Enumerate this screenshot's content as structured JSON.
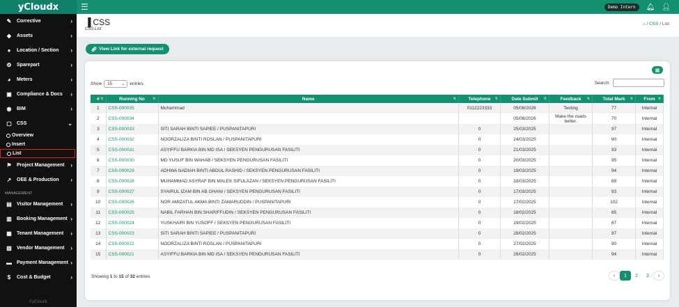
{
  "brand": "yCloudx",
  "topbar": {
    "demo_label": "Demo Intern"
  },
  "sidebar": {
    "items_top": [
      {
        "label": "Corrective",
        "icon": "wrench-icon"
      },
      {
        "label": "Assets",
        "icon": "tag-icon"
      },
      {
        "label": "Location / Section",
        "icon": "globe-icon"
      },
      {
        "label": "Sparepart",
        "icon": "sparepart-icon"
      },
      {
        "label": "Meters",
        "icon": "gauge-icon"
      },
      {
        "label": "Compliance & Docs",
        "icon": "compliance-icon"
      },
      {
        "label": "BIM",
        "icon": "bim-icon"
      },
      {
        "label": "CSS",
        "icon": "chat-icon"
      }
    ],
    "css_subs": [
      "Overview",
      "Insert",
      "List"
    ],
    "items_mid": [
      {
        "label": "Project Management",
        "icon": "flag-icon"
      },
      {
        "label": "OEE & Production",
        "icon": "chart-icon"
      }
    ],
    "section": "MANAGEMENT",
    "items_bottom": [
      {
        "label": "Visitor Management",
        "icon": "visitor-icon"
      },
      {
        "label": "Booking Management",
        "icon": "booking-icon"
      },
      {
        "label": "Tenant Management",
        "icon": "tenant-icon"
      },
      {
        "label": "Vendor Management",
        "icon": "vendor-icon"
      },
      {
        "label": "Payment Management",
        "icon": "card-icon"
      },
      {
        "label": "Cost & Budget",
        "icon": "dollar-icon"
      }
    ],
    "footer": "©yCloudx"
  },
  "page": {
    "title": "CSS",
    "subtitle": "CSS List",
    "breadcrumb": [
      "CSS",
      "List"
    ],
    "ext_button": "View Link for external request"
  },
  "table": {
    "show_label": "Show",
    "entries_label": "entries",
    "page_size": "15",
    "search_label": "Search:",
    "headers": [
      "#",
      "Running No",
      "Name",
      "Telephone",
      "Date Submit",
      "Feedback",
      "Total Mark",
      "From"
    ],
    "rows": [
      [
        "1",
        "CSS-000035",
        "Muhammad",
        "0112223333",
        "05/08/2026",
        "Testing",
        "77",
        "Internal"
      ],
      [
        "2",
        "CSS-000034",
        "",
        "",
        "05/08/2026",
        "Make the roads better.",
        "70",
        "Internal"
      ],
      [
        "3",
        "CSS-000033",
        "SITI SARAH BINTI SAPIEE / PUSPANITAPURI",
        "0",
        "25/03/2025",
        "",
        "97",
        "Internal"
      ],
      [
        "4",
        "CSS-000032",
        "NOORZALIZA BINTI ROSLAN / PUSPANITAPURI",
        "0",
        "24/03/2025",
        "",
        "90",
        "Internal"
      ],
      [
        "5",
        "CSS-000031",
        "ASYIFFU BARKIA BIN MD ISA / SEKSYEN PENGURUSAN FASILITI",
        "0",
        "21/03/2025",
        "",
        "93",
        "Internal"
      ],
      [
        "6",
        "CSS-000030",
        "MD YUSUF BIN WAHAB / SEKSYEN PENGURUSAN FASILITI",
        "0",
        "20/03/2025",
        "",
        "95",
        "Internal"
      ],
      [
        "7",
        "CSS-000029",
        "ADHWA NADIAH BINTI ABDUL RASHID / SEKSYEN PENGURUSAN FASILITI",
        "0",
        "19/03/2025",
        "",
        "94",
        "Internal"
      ],
      [
        "8",
        "CSS-000028",
        "MUHAMMAD ASYRAF BIN MALEK SIFULAZAN / SEKSYEN PENGURUSAN FASILITI",
        "0",
        "18/03/2025",
        "",
        "89",
        "Internal"
      ],
      [
        "9",
        "CSS-000027",
        "SYAIRUL IZAM BIN AB GHANI / SEKSYEN PENGURUSAN FASILITI",
        "0",
        "17/03/2025",
        "",
        "93",
        "Internal"
      ],
      [
        "10",
        "CSS-000026",
        "NOR AMIZATUL AKMA BINTI ZAMARUDDIN / PUSPANITAPURI",
        "0",
        "17/02/2025",
        "",
        "102",
        "Internal"
      ],
      [
        "11",
        "CSS-000025",
        "NABIL FARHAN BIN SHARIFFUDIN / SEKSYEN PENGURUSAN FASILITI",
        "0",
        "18/02/2025",
        "",
        "85",
        "Internal"
      ],
      [
        "12",
        "CSS-000024",
        "YUSKHAIRI BIN YUSOFF / SEKSYEN PENGURUSAN FASILITI",
        "0",
        "19/02/2025",
        "",
        "87",
        "Internal"
      ],
      [
        "13",
        "CSS-000023",
        "SITI SARAH BINTI SAPIEE / PUSPANITAPURI",
        "0",
        "28/02/2025",
        "",
        "97",
        "Internal"
      ],
      [
        "14",
        "CSS-000022",
        "NOORZALIZA BINTI ROSLAN / PUSPANITAPURI",
        "0",
        "27/02/2025",
        "",
        "90",
        "Internal"
      ],
      [
        "15",
        "CSS-000021",
        "ASYIFFU BARKIA BIN MD ISA / SEKSYEN PENGURUSAN FASILITI",
        "0",
        "26/02/2025",
        "",
        "94",
        "Internal"
      ]
    ],
    "info": {
      "prefix": "Showing",
      "from": "1",
      "to_word": "to",
      "to": "15",
      "of_word": "of",
      "total": "32",
      "suffix": "entries"
    },
    "pages": [
      "1",
      "2",
      "3"
    ]
  },
  "colors": {
    "accent": "#13906f",
    "sidebar": "#111111"
  }
}
